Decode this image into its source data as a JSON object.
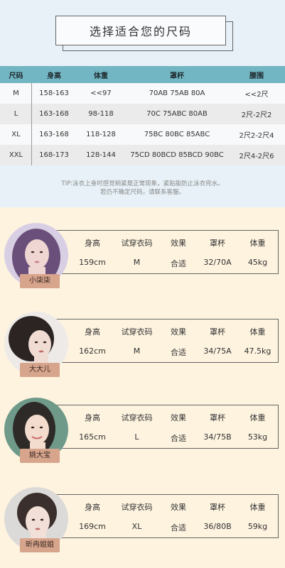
{
  "title": "选择适合您的尺码",
  "size_table": {
    "headers": [
      "尺码",
      "身高",
      "体重",
      "罩杯",
      "腰围"
    ],
    "rows": [
      [
        "M",
        "158-163",
        "<<97",
        "70AB 75AB 80A",
        "<<2尺"
      ],
      [
        "L",
        "163-168",
        "98-118",
        "70C 75ABC 80AB",
        "2尺-2尺2"
      ],
      [
        "XL",
        "163-168",
        "118-128",
        "75BC 80BC 85ABC",
        "2尺2-2尺4"
      ],
      [
        "XXL",
        "168-173",
        "128-144",
        "75CD 80BCD 85BCD 90BC",
        "2尺4-2尺6"
      ]
    ]
  },
  "tip": {
    "line1": "TIP:泳衣上身时感觉稍紧是正常现象，紧贴能防止泳衣兜水。",
    "line2": "若仍不确定尺码，请联系客服。"
  },
  "model_labels": [
    "身高",
    "试穿衣码",
    "效果",
    "罩杯",
    "体重"
  ],
  "models": [
    {
      "name": "小柒柒",
      "values": [
        "159cm",
        "M",
        "合适",
        "32/70A",
        "45kg"
      ],
      "hair": "#6a4f7a",
      "skin": "#efd6d2",
      "bg": "#d8cfe4"
    },
    {
      "name": "大大儿",
      "values": [
        "162cm",
        "M",
        "合适",
        "34/75A",
        "47.5kg"
      ],
      "hair": "#2b2422",
      "skin": "#f0dcd2",
      "bg": "#eeeae8"
    },
    {
      "name": "姚大宝",
      "values": [
        "165cm",
        "L",
        "合适",
        "34/75B",
        "53kg"
      ],
      "hair": "#2d2a28",
      "skin": "#f3dccd",
      "bg": "#6f9a8a"
    },
    {
      "name": "昕冉姐姐",
      "values": [
        "169cm",
        "XL",
        "合适",
        "36/80B",
        "59kg"
      ],
      "hair": "#3a2f2c",
      "skin": "#f2e0d8",
      "bg": "#dcdad8"
    }
  ]
}
